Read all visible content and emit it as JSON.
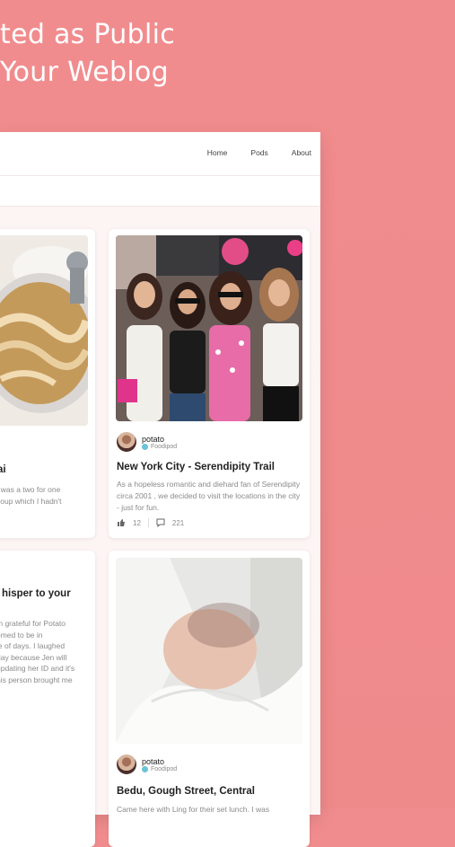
{
  "hero": {
    "line1": "ted as Public",
    "line2": "Your Weblog"
  },
  "nav": {
    "home": "Home",
    "pods": "Pods",
    "about": "About"
  },
  "left_column": {
    "card1": {
      "title_fragment": "nai",
      "desc_line1": ", was a two for one",
      "desc_line2": "soup which I hadn't"
    },
    "card2": {
      "title_fragment": "hisper to your",
      "desc_line1": "m grateful for Potato",
      "desc_line2": "emed to be in",
      "desc_line3": "le of days. I laughed",
      "desc_line4": "day because Jen will",
      "desc_line5": "updating her ID and it's",
      "desc_line6": "his person brought me"
    }
  },
  "right_column": {
    "card1": {
      "author": "potato",
      "pod": "Foodipod",
      "title": "New York City - Serendipity Trail",
      "desc": "As a hopeless romantic and diehard fan of Serendipity circa 2001 , we decided to visit the locations in the city - just for fun.",
      "likes": "12",
      "comments": "221"
    },
    "card2": {
      "author": "potato",
      "pod": "Foodipod",
      "title": "Bedu, Gough Street, Central",
      "desc": "Came here with Ling for their set lunch. I was"
    }
  },
  "colors": {
    "background": "#f08b8d",
    "card": "#ffffff",
    "pod_dot": "#6ac3d9"
  }
}
